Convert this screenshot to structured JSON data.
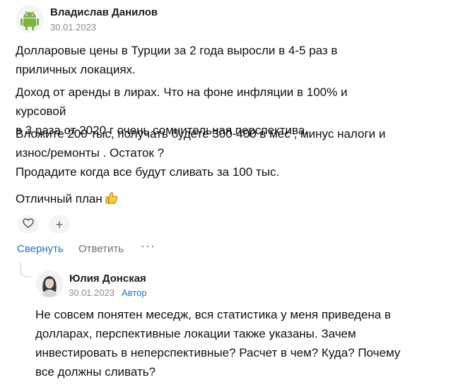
{
  "comment": {
    "author": "Владислав Данилов",
    "date": "30.01.2023",
    "avatar_icon": "android-icon",
    "paragraphs": [
      "Долларовые цены в Турции за 2 года выросли в 4-5 раз в приличных локациях.",
      "Доход от аренды в лирах. Что на фоне инфляции в 100% и курсовой в 3 раза от 2020 г очень сомнительная перспектива.",
      "Вложите 200 тыс, получать будете 300-400 в мес , минус налоги и износ/ремонты . Остаток ?",
      "Продадите когда все будут сливать за 100 тыс.",
      "Отличный план"
    ],
    "paragraph_lines": {
      "p1": [
        "Долларовые цены в Турции за 2 года выросли в 4-5 раз в",
        "приличных локациях."
      ],
      "p2": [
        "Доход от аренды в лирах. Что на фоне инфляции в 100% и курсовой",
        "в 3 раза от 2020 г очень сомнительная перспектива."
      ],
      "p3": "Вложите 200 тыс, получать будете 300-400 в мес , минус налоги и",
      "p4": "износ/ремонты . Остаток ?"
    },
    "emoji": "thumbs-up-icon",
    "reactions": {
      "like_icon": "heart-icon",
      "add_label": "+"
    },
    "actions": {
      "collapse": "Свернуть",
      "reply": "Ответить",
      "more": "···"
    }
  },
  "reply": {
    "author": "Юлия Донская",
    "date": "30.01.2023",
    "badge": "Автор",
    "avatar_icon": "user-photo",
    "text_lines": [
      "Не совсем понятен меседж, вся статистика у меня приведена в",
      "долларах, перспективные локации также указаны. Зачем",
      "инвестировать в неперспективные? Расчет в чем? Куда? Почему",
      "все должны сливать?"
    ]
  },
  "colors": {
    "link": "#1f6fd1",
    "muted": "#8a8d93",
    "android_green": "#7cb342"
  }
}
